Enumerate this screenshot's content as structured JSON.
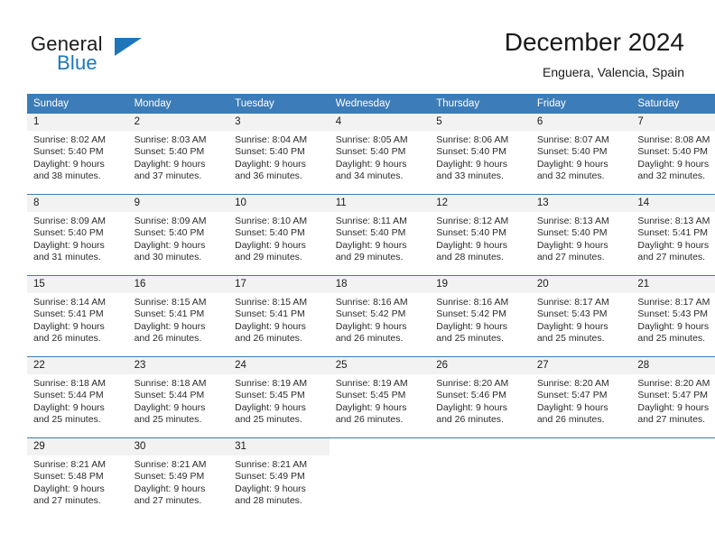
{
  "brand": {
    "name_part1": "General",
    "name_part2": "Blue",
    "flag_icon": "triangle-flag-icon",
    "accent_color": "#1d76bb"
  },
  "header": {
    "month_title": "December 2024",
    "location": "Enguera, Valencia, Spain"
  },
  "calendar": {
    "header_bg": "#3c7cb8",
    "daynum_bg": "#f2f2f2",
    "weekday_headers": [
      "Sunday",
      "Monday",
      "Tuesday",
      "Wednesday",
      "Thursday",
      "Friday",
      "Saturday"
    ],
    "weeks": [
      [
        {
          "day": "1",
          "sunrise": "Sunrise: 8:02 AM",
          "sunset": "Sunset: 5:40 PM",
          "daylight_line1": "Daylight: 9 hours",
          "daylight_line2": "and 38 minutes."
        },
        {
          "day": "2",
          "sunrise": "Sunrise: 8:03 AM",
          "sunset": "Sunset: 5:40 PM",
          "daylight_line1": "Daylight: 9 hours",
          "daylight_line2": "and 37 minutes."
        },
        {
          "day": "3",
          "sunrise": "Sunrise: 8:04 AM",
          "sunset": "Sunset: 5:40 PM",
          "daylight_line1": "Daylight: 9 hours",
          "daylight_line2": "and 36 minutes."
        },
        {
          "day": "4",
          "sunrise": "Sunrise: 8:05 AM",
          "sunset": "Sunset: 5:40 PM",
          "daylight_line1": "Daylight: 9 hours",
          "daylight_line2": "and 34 minutes."
        },
        {
          "day": "5",
          "sunrise": "Sunrise: 8:06 AM",
          "sunset": "Sunset: 5:40 PM",
          "daylight_line1": "Daylight: 9 hours",
          "daylight_line2": "and 33 minutes."
        },
        {
          "day": "6",
          "sunrise": "Sunrise: 8:07 AM",
          "sunset": "Sunset: 5:40 PM",
          "daylight_line1": "Daylight: 9 hours",
          "daylight_line2": "and 32 minutes."
        },
        {
          "day": "7",
          "sunrise": "Sunrise: 8:08 AM",
          "sunset": "Sunset: 5:40 PM",
          "daylight_line1": "Daylight: 9 hours",
          "daylight_line2": "and 32 minutes."
        }
      ],
      [
        {
          "day": "8",
          "sunrise": "Sunrise: 8:09 AM",
          "sunset": "Sunset: 5:40 PM",
          "daylight_line1": "Daylight: 9 hours",
          "daylight_line2": "and 31 minutes."
        },
        {
          "day": "9",
          "sunrise": "Sunrise: 8:09 AM",
          "sunset": "Sunset: 5:40 PM",
          "daylight_line1": "Daylight: 9 hours",
          "daylight_line2": "and 30 minutes."
        },
        {
          "day": "10",
          "sunrise": "Sunrise: 8:10 AM",
          "sunset": "Sunset: 5:40 PM",
          "daylight_line1": "Daylight: 9 hours",
          "daylight_line2": "and 29 minutes."
        },
        {
          "day": "11",
          "sunrise": "Sunrise: 8:11 AM",
          "sunset": "Sunset: 5:40 PM",
          "daylight_line1": "Daylight: 9 hours",
          "daylight_line2": "and 29 minutes."
        },
        {
          "day": "12",
          "sunrise": "Sunrise: 8:12 AM",
          "sunset": "Sunset: 5:40 PM",
          "daylight_line1": "Daylight: 9 hours",
          "daylight_line2": "and 28 minutes."
        },
        {
          "day": "13",
          "sunrise": "Sunrise: 8:13 AM",
          "sunset": "Sunset: 5:40 PM",
          "daylight_line1": "Daylight: 9 hours",
          "daylight_line2": "and 27 minutes."
        },
        {
          "day": "14",
          "sunrise": "Sunrise: 8:13 AM",
          "sunset": "Sunset: 5:41 PM",
          "daylight_line1": "Daylight: 9 hours",
          "daylight_line2": "and 27 minutes."
        }
      ],
      [
        {
          "day": "15",
          "sunrise": "Sunrise: 8:14 AM",
          "sunset": "Sunset: 5:41 PM",
          "daylight_line1": "Daylight: 9 hours",
          "daylight_line2": "and 26 minutes."
        },
        {
          "day": "16",
          "sunrise": "Sunrise: 8:15 AM",
          "sunset": "Sunset: 5:41 PM",
          "daylight_line1": "Daylight: 9 hours",
          "daylight_line2": "and 26 minutes."
        },
        {
          "day": "17",
          "sunrise": "Sunrise: 8:15 AM",
          "sunset": "Sunset: 5:41 PM",
          "daylight_line1": "Daylight: 9 hours",
          "daylight_line2": "and 26 minutes."
        },
        {
          "day": "18",
          "sunrise": "Sunrise: 8:16 AM",
          "sunset": "Sunset: 5:42 PM",
          "daylight_line1": "Daylight: 9 hours",
          "daylight_line2": "and 26 minutes."
        },
        {
          "day": "19",
          "sunrise": "Sunrise: 8:16 AM",
          "sunset": "Sunset: 5:42 PM",
          "daylight_line1": "Daylight: 9 hours",
          "daylight_line2": "and 25 minutes."
        },
        {
          "day": "20",
          "sunrise": "Sunrise: 8:17 AM",
          "sunset": "Sunset: 5:43 PM",
          "daylight_line1": "Daylight: 9 hours",
          "daylight_line2": "and 25 minutes."
        },
        {
          "day": "21",
          "sunrise": "Sunrise: 8:17 AM",
          "sunset": "Sunset: 5:43 PM",
          "daylight_line1": "Daylight: 9 hours",
          "daylight_line2": "and 25 minutes."
        }
      ],
      [
        {
          "day": "22",
          "sunrise": "Sunrise: 8:18 AM",
          "sunset": "Sunset: 5:44 PM",
          "daylight_line1": "Daylight: 9 hours",
          "daylight_line2": "and 25 minutes."
        },
        {
          "day": "23",
          "sunrise": "Sunrise: 8:18 AM",
          "sunset": "Sunset: 5:44 PM",
          "daylight_line1": "Daylight: 9 hours",
          "daylight_line2": "and 25 minutes."
        },
        {
          "day": "24",
          "sunrise": "Sunrise: 8:19 AM",
          "sunset": "Sunset: 5:45 PM",
          "daylight_line1": "Daylight: 9 hours",
          "daylight_line2": "and 25 minutes."
        },
        {
          "day": "25",
          "sunrise": "Sunrise: 8:19 AM",
          "sunset": "Sunset: 5:45 PM",
          "daylight_line1": "Daylight: 9 hours",
          "daylight_line2": "and 26 minutes."
        },
        {
          "day": "26",
          "sunrise": "Sunrise: 8:20 AM",
          "sunset": "Sunset: 5:46 PM",
          "daylight_line1": "Daylight: 9 hours",
          "daylight_line2": "and 26 minutes."
        },
        {
          "day": "27",
          "sunrise": "Sunrise: 8:20 AM",
          "sunset": "Sunset: 5:47 PM",
          "daylight_line1": "Daylight: 9 hours",
          "daylight_line2": "and 26 minutes."
        },
        {
          "day": "28",
          "sunrise": "Sunrise: 8:20 AM",
          "sunset": "Sunset: 5:47 PM",
          "daylight_line1": "Daylight: 9 hours",
          "daylight_line2": "and 27 minutes."
        }
      ],
      [
        {
          "day": "29",
          "sunrise": "Sunrise: 8:21 AM",
          "sunset": "Sunset: 5:48 PM",
          "daylight_line1": "Daylight: 9 hours",
          "daylight_line2": "and 27 minutes."
        },
        {
          "day": "30",
          "sunrise": "Sunrise: 8:21 AM",
          "sunset": "Sunset: 5:49 PM",
          "daylight_line1": "Daylight: 9 hours",
          "daylight_line2": "and 27 minutes."
        },
        {
          "day": "31",
          "sunrise": "Sunrise: 8:21 AM",
          "sunset": "Sunset: 5:49 PM",
          "daylight_line1": "Daylight: 9 hours",
          "daylight_line2": "and 28 minutes."
        },
        null,
        null,
        null,
        null
      ]
    ]
  }
}
